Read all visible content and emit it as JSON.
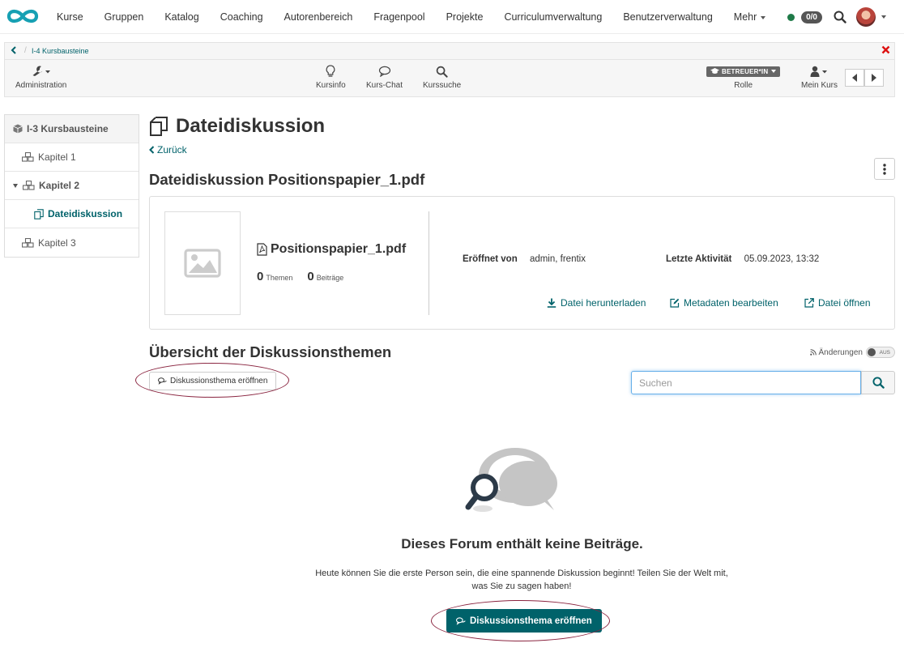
{
  "nav": {
    "items": [
      {
        "label": "Kurse",
        "name": "nav-kurse"
      },
      {
        "label": "Gruppen",
        "name": "nav-gruppen"
      },
      {
        "label": "Katalog",
        "name": "nav-katalog"
      },
      {
        "label": "Coaching",
        "name": "nav-coaching"
      },
      {
        "label": "Autorenbereich",
        "name": "nav-autorenbereich"
      },
      {
        "label": "Fragenpool",
        "name": "nav-fragenpool"
      },
      {
        "label": "Projekte",
        "name": "nav-projekte"
      },
      {
        "label": "Curriculumverwaltung",
        "name": "nav-curriculumverwaltung"
      },
      {
        "label": "Benutzerverwaltung",
        "name": "nav-benutzerverwaltung"
      },
      {
        "label": "Mehr",
        "name": "nav-mehr",
        "caret": true
      }
    ],
    "badge": "0/0",
    "status_color": "#1f7a48"
  },
  "toolbar": {
    "breadcrumb": "I-4 Kursbausteine",
    "administration": "Administration",
    "kursinfo": "Kursinfo",
    "kurschat": "Kurs-Chat",
    "kurssuche": "Kurssuche",
    "role_badge": "BETREUER*IN",
    "role_label": "Rolle",
    "mein_kurs": "Mein Kurs"
  },
  "menu": {
    "root": "I-3 Kursbausteine",
    "kapitel1": "Kapitel 1",
    "kapitel2": "Kapitel 2",
    "dateidiskussion": "Dateidiskussion",
    "kapitel3": "Kapitel 3"
  },
  "main": {
    "title": "Dateidiskussion",
    "back": "Zurück",
    "subtitle": "Dateidiskussion Positionspapier_1.pdf",
    "file": {
      "name": "Positionspapier_1.pdf",
      "themen_count": "0",
      "themen_label": "Themen",
      "beitraege_count": "0",
      "beitraege_label": "Beiträge",
      "opened_by_label": "Eröffnet von",
      "opened_by": "admin, frentix",
      "last_activity_label": "Letzte Aktivität",
      "last_activity": "05.09.2023, 13:32",
      "download": "Datei herunterladen",
      "edit_meta": "Metadaten bearbeiten",
      "open": "Datei öffnen"
    },
    "overview_title": "Übersicht der Diskussionsthemen",
    "changes_label": "Änderungen",
    "toggle_label": "AUS",
    "new_topic": "Diskussionsthema eröffnen",
    "search_placeholder": "Suchen",
    "empty_title": "Dieses Forum enthält keine Beiträge.",
    "empty_text": "Heute können Sie die erste Person sein, die eine spannende Diskussion beginnt! Teilen Sie der Welt mit, was Sie zu sagen haben!",
    "new_topic_main": "Diskussionsthema eröffnen"
  },
  "colors": {
    "accent": "#00626a",
    "highlight_ellipse": "#8a2540"
  }
}
